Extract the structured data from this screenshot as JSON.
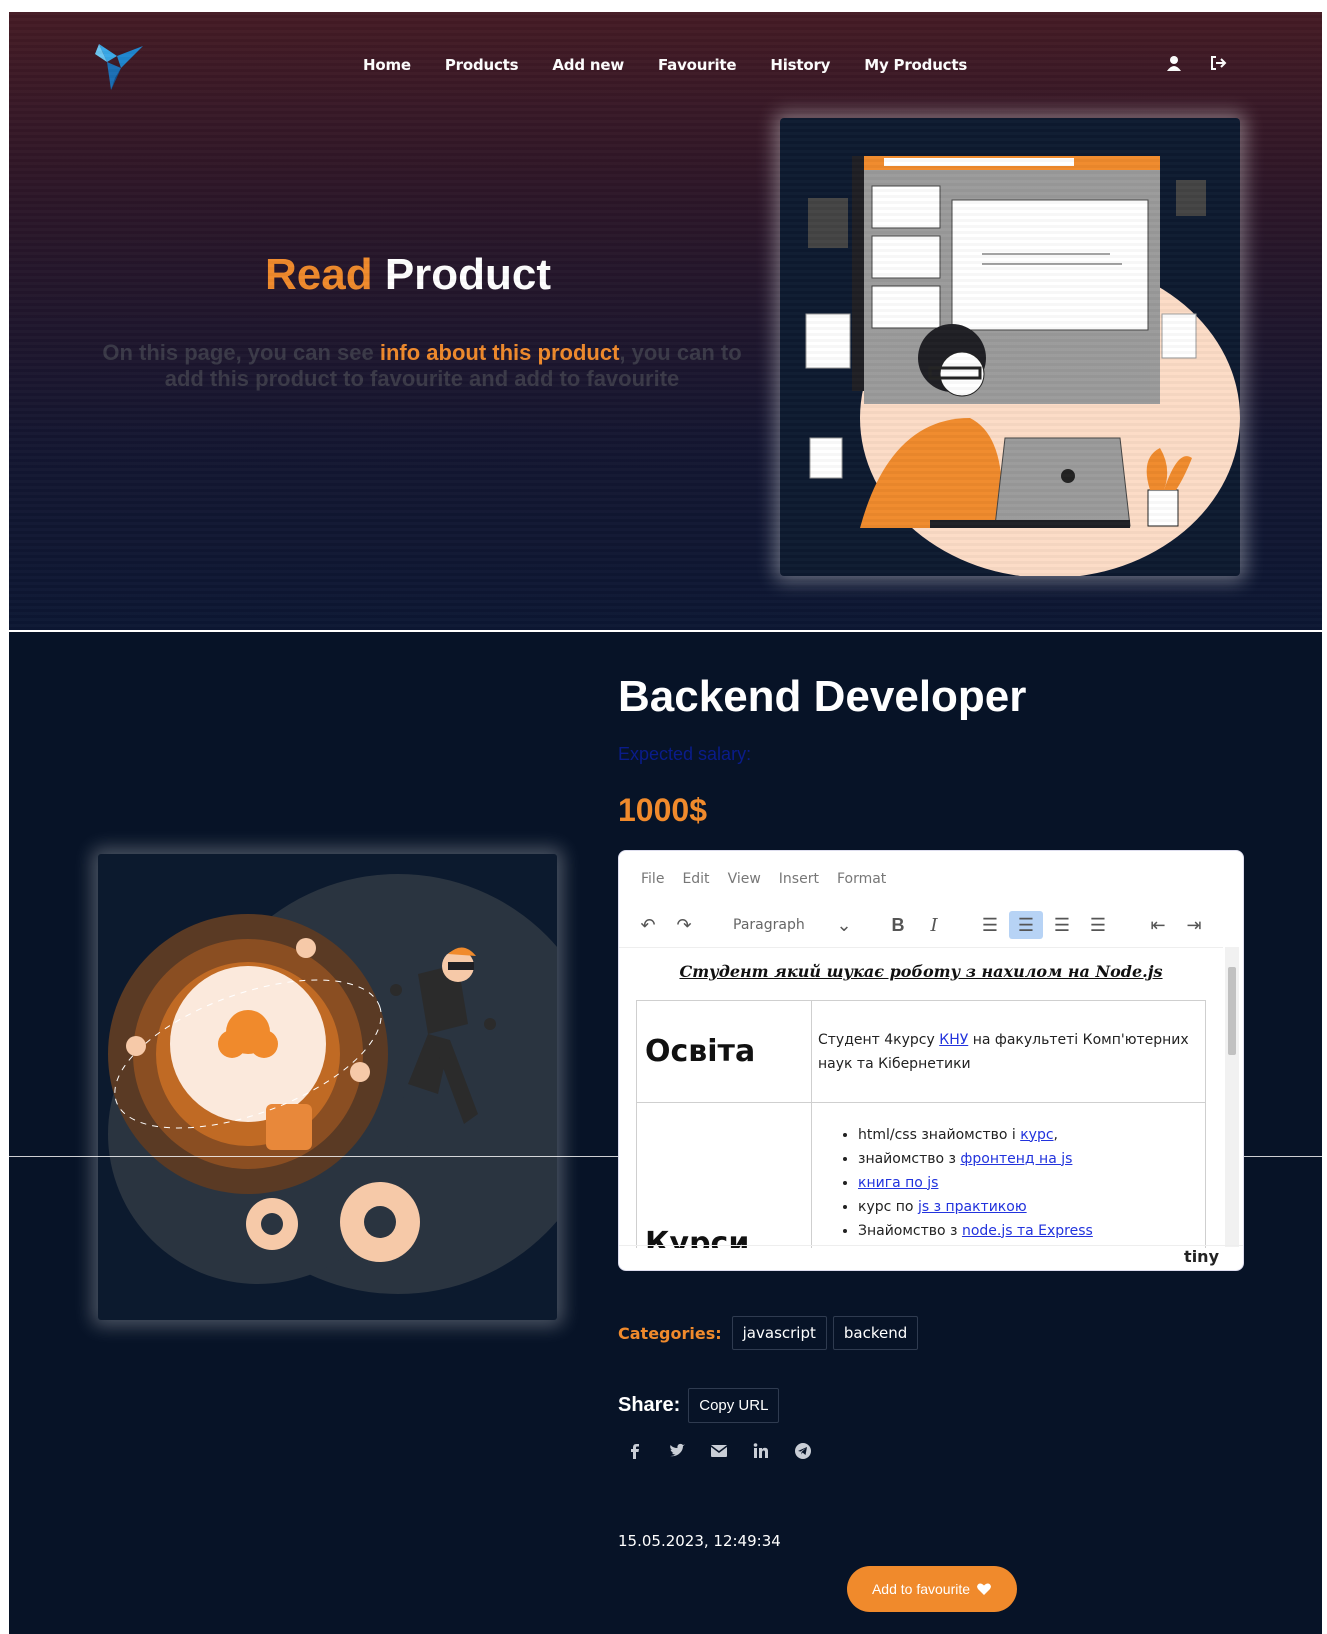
{
  "nav": {
    "items": [
      "Home",
      "Products",
      "Add new",
      "Favourite",
      "History",
      "My Products"
    ],
    "icons": [
      "user-icon",
      "logout-icon"
    ]
  },
  "hero": {
    "title_accent": "Read",
    "title_rest": "Product",
    "sub_pre": "On this page, you can see ",
    "sub_hl": "info about this product",
    "sub_post": ", you can to add this product to favourite and add to favourite"
  },
  "product": {
    "title": "Backend Developer",
    "salary_label": "Expected salary:",
    "salary": "1000$"
  },
  "editor": {
    "menu": [
      "File",
      "Edit",
      "View",
      "Insert",
      "Format"
    ],
    "block_format": "Paragraph",
    "doc_title": "Студент який шукає роботу з нахилом на Node.js",
    "rows": [
      {
        "header": "Освіта",
        "text_pre": "Студент 4курсу ",
        "link": "КНУ",
        "text_post": " на факультеті Комп'ютерних наук та Кібернетики"
      },
      {
        "header": "Курси",
        "items": [
          {
            "pre": "html/css знайомство і ",
            "link": "курс",
            "post": ","
          },
          {
            "pre": "знайомство з ",
            "link": "фронтенд на js",
            "post": ""
          },
          {
            "pre": "",
            "link": "книга по js",
            "post": ""
          },
          {
            "pre": "курс по ",
            "link": "js з практикою",
            "post": ""
          },
          {
            "pre": "Знайомство з ",
            "link": "node.js та Express",
            "post": ""
          }
        ]
      }
    ],
    "brand": "tiny"
  },
  "categories": {
    "label": "Categories:",
    "tags": [
      "javascript",
      "backend"
    ]
  },
  "share": {
    "label": "Share:",
    "copy_label": "Copy URL",
    "icons": [
      "facebook-icon",
      "twitter-icon",
      "email-icon",
      "linkedin-icon",
      "telegram-icon"
    ]
  },
  "date": "15.05.2023, 12:49:34",
  "favourite_label": "Add to favourite",
  "colors": {
    "accent": "#f08a2c",
    "background": "#071327",
    "salary_label": "#0a1c8a"
  }
}
